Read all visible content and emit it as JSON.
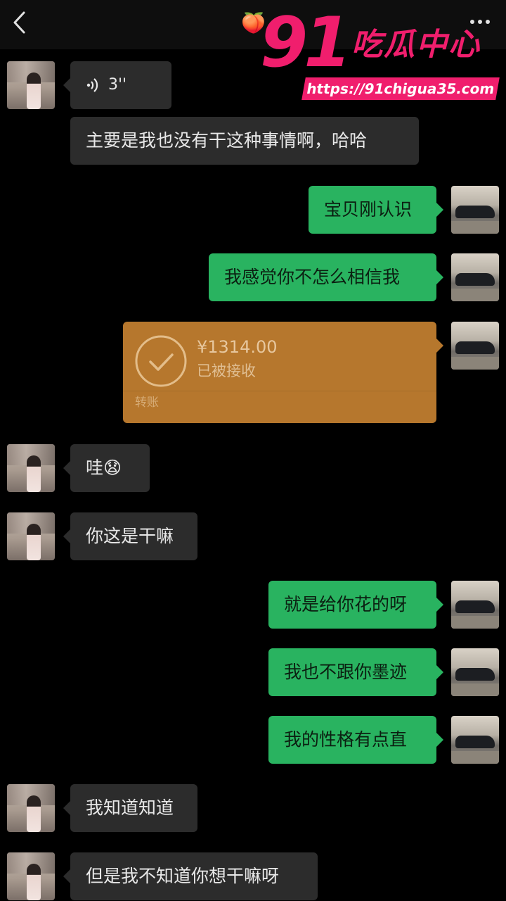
{
  "header": {
    "back_icon": "chevron-left-icon",
    "peach_emoji": "🍑",
    "more_icon": "more-horizontal-icon"
  },
  "watermark": {
    "number": "91",
    "title": "吃瓜中心",
    "url": "https://91chigua35.com"
  },
  "messages": [
    {
      "side": "left",
      "type": "voice",
      "duration": "3''"
    },
    {
      "side": "left",
      "type": "text",
      "text": "主要是我也没有干这种事情啊，哈哈"
    },
    {
      "side": "right",
      "type": "text",
      "text": "宝贝刚认识"
    },
    {
      "side": "right",
      "type": "text",
      "text": "我感觉你不怎么相信我"
    },
    {
      "side": "right",
      "type": "transfer",
      "amount": "¥1314.00",
      "status": "已被接收",
      "label": "转账"
    },
    {
      "side": "left",
      "type": "text",
      "text": "哇😧"
    },
    {
      "side": "left",
      "type": "text",
      "text": "你这是干嘛"
    },
    {
      "side": "right",
      "type": "text",
      "text": "就是给你花的呀"
    },
    {
      "side": "right",
      "type": "text",
      "text": "我也不跟你墨迹"
    },
    {
      "side": "right",
      "type": "text",
      "text": "我的性格有点直"
    },
    {
      "side": "left",
      "type": "text",
      "text": "我知道知道"
    },
    {
      "side": "left",
      "type": "text",
      "text": "但是我不知道你想干嘛呀"
    }
  ],
  "colors": {
    "background": "#000000",
    "bubble_left": "#2c2c2c",
    "bubble_right": "#29b360",
    "transfer": "#b6772d",
    "watermark": "#f01e6d"
  }
}
